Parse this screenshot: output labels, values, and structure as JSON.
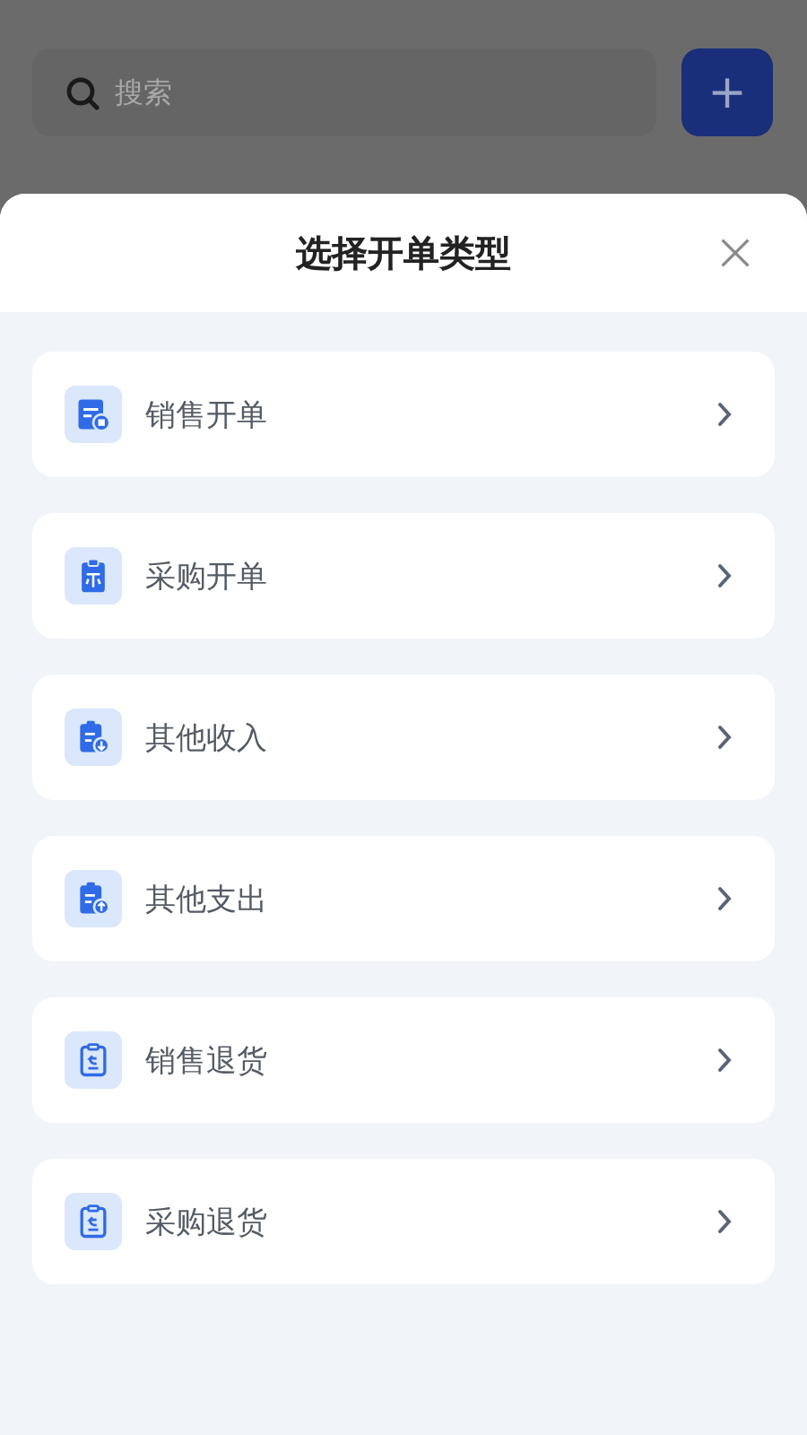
{
  "search": {
    "placeholder": "搜索"
  },
  "add_button": {
    "label": "+"
  },
  "sheet": {
    "title": "选择开单类型",
    "options": [
      {
        "label": "销售开单",
        "kind": "form"
      },
      {
        "label": "采购开单",
        "kind": "clipboard"
      },
      {
        "label": "其他收入",
        "kind": "income"
      },
      {
        "label": "其他支出",
        "kind": "expense"
      },
      {
        "label": "销售退货",
        "kind": "return"
      },
      {
        "label": "采购退货",
        "kind": "return"
      }
    ]
  }
}
